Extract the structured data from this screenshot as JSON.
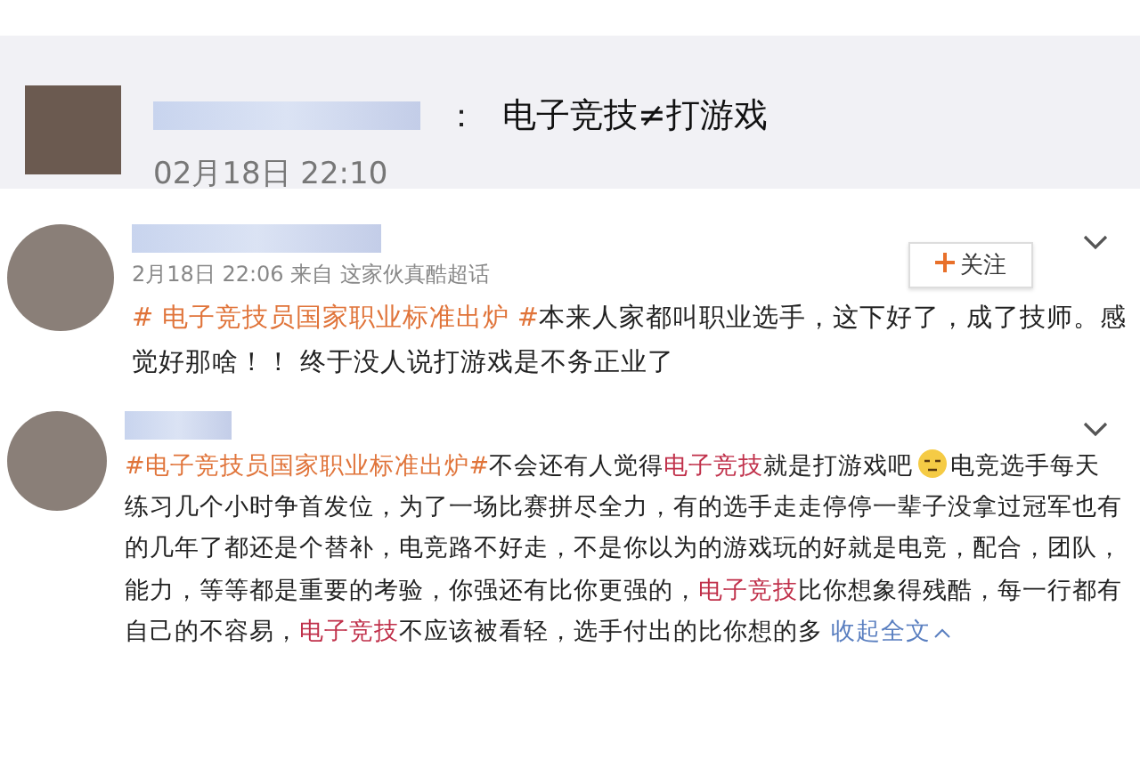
{
  "quote_post": {
    "separator": "：",
    "text": "电子竞技≠打游戏",
    "time": "02月18日 22:10"
  },
  "posts": [
    {
      "meta": "2月18日 22:06 来自 这家伙真酷超话",
      "follow_button": "关注",
      "has_menu": true,
      "body": [
        {
          "kind": "hashtag",
          "text": "# 电子竞技员国家职业标准出炉 #"
        },
        {
          "kind": "text",
          "text": "本来人家都叫职业选手，这下好了，成了技师。感觉好那啥！！ 终于没人说打游戏是不务正业了"
        }
      ]
    },
    {
      "has_menu": true,
      "body": [
        {
          "kind": "hashtag",
          "text": "#电子竞技员国家职业标准出炉#"
        },
        {
          "kind": "text",
          "text": "不会还有人觉得"
        },
        {
          "kind": "keyword",
          "text": "电子竞技"
        },
        {
          "kind": "text",
          "text": "就是打游戏吧"
        },
        {
          "kind": "emoji"
        },
        {
          "kind": "text",
          "text": "电竞选手每天练习几个小时争首发位，为了一场比赛拼尽全力，有的选手走走停停一辈子没拿过冠军也有的几年了都还是个替补，电竞路不好走，不是你以为的游戏玩的好就是电竞，配合，团队，能力，等等都是重要的考验，你强还有比你更强的，"
        },
        {
          "kind": "keyword",
          "text": "电子竞技"
        },
        {
          "kind": "text",
          "text": "比你想象得残酷，每一行都有自己的不容易，"
        },
        {
          "kind": "keyword",
          "text": "电子竞技"
        },
        {
          "kind": "text",
          "text": "不应该被看轻，选手付出的比你想的多 "
        },
        {
          "kind": "link",
          "text": "收起全文"
        }
      ]
    }
  ]
}
